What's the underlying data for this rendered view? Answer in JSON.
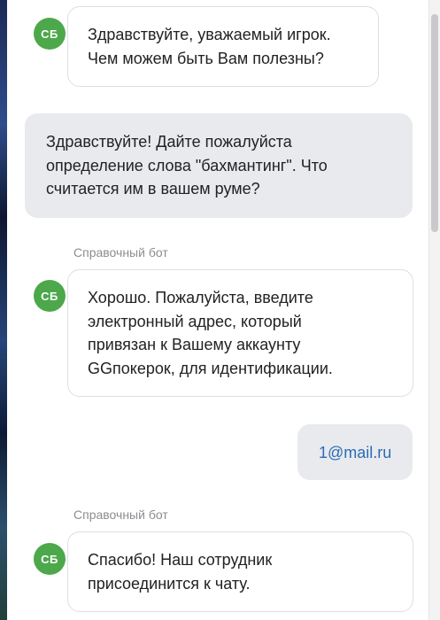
{
  "messages": [
    {
      "role": "bot",
      "avatar": "СБ",
      "sender": "",
      "text": "Здравствуйте, уважаемый игрок.\nЧем можем быть Вам полезны?"
    },
    {
      "role": "user",
      "text": "Здравствуйте! Дайте пожалуйста\nопределение слова \"бахмантинг\". Что\nсчитается им в вашем руме?"
    },
    {
      "role": "bot",
      "avatar": "СБ",
      "sender": "Справочный бот",
      "text": "Хорошо. Пожалуйста, введите\nэлектронный адрес, который\nпривязан к Вашему аккаунту\nGGпокерок, для идентификации."
    },
    {
      "role": "user",
      "text": "1@mail.ru"
    },
    {
      "role": "bot",
      "avatar": "СБ",
      "sender": "Справочный бот",
      "text": "Спасибо! Наш сотрудник\nприсоединится к чату."
    }
  ],
  "colors": {
    "avatar": "#4ca84a",
    "user_bubble": "#e8eaed",
    "link": "#2d6cb5"
  }
}
